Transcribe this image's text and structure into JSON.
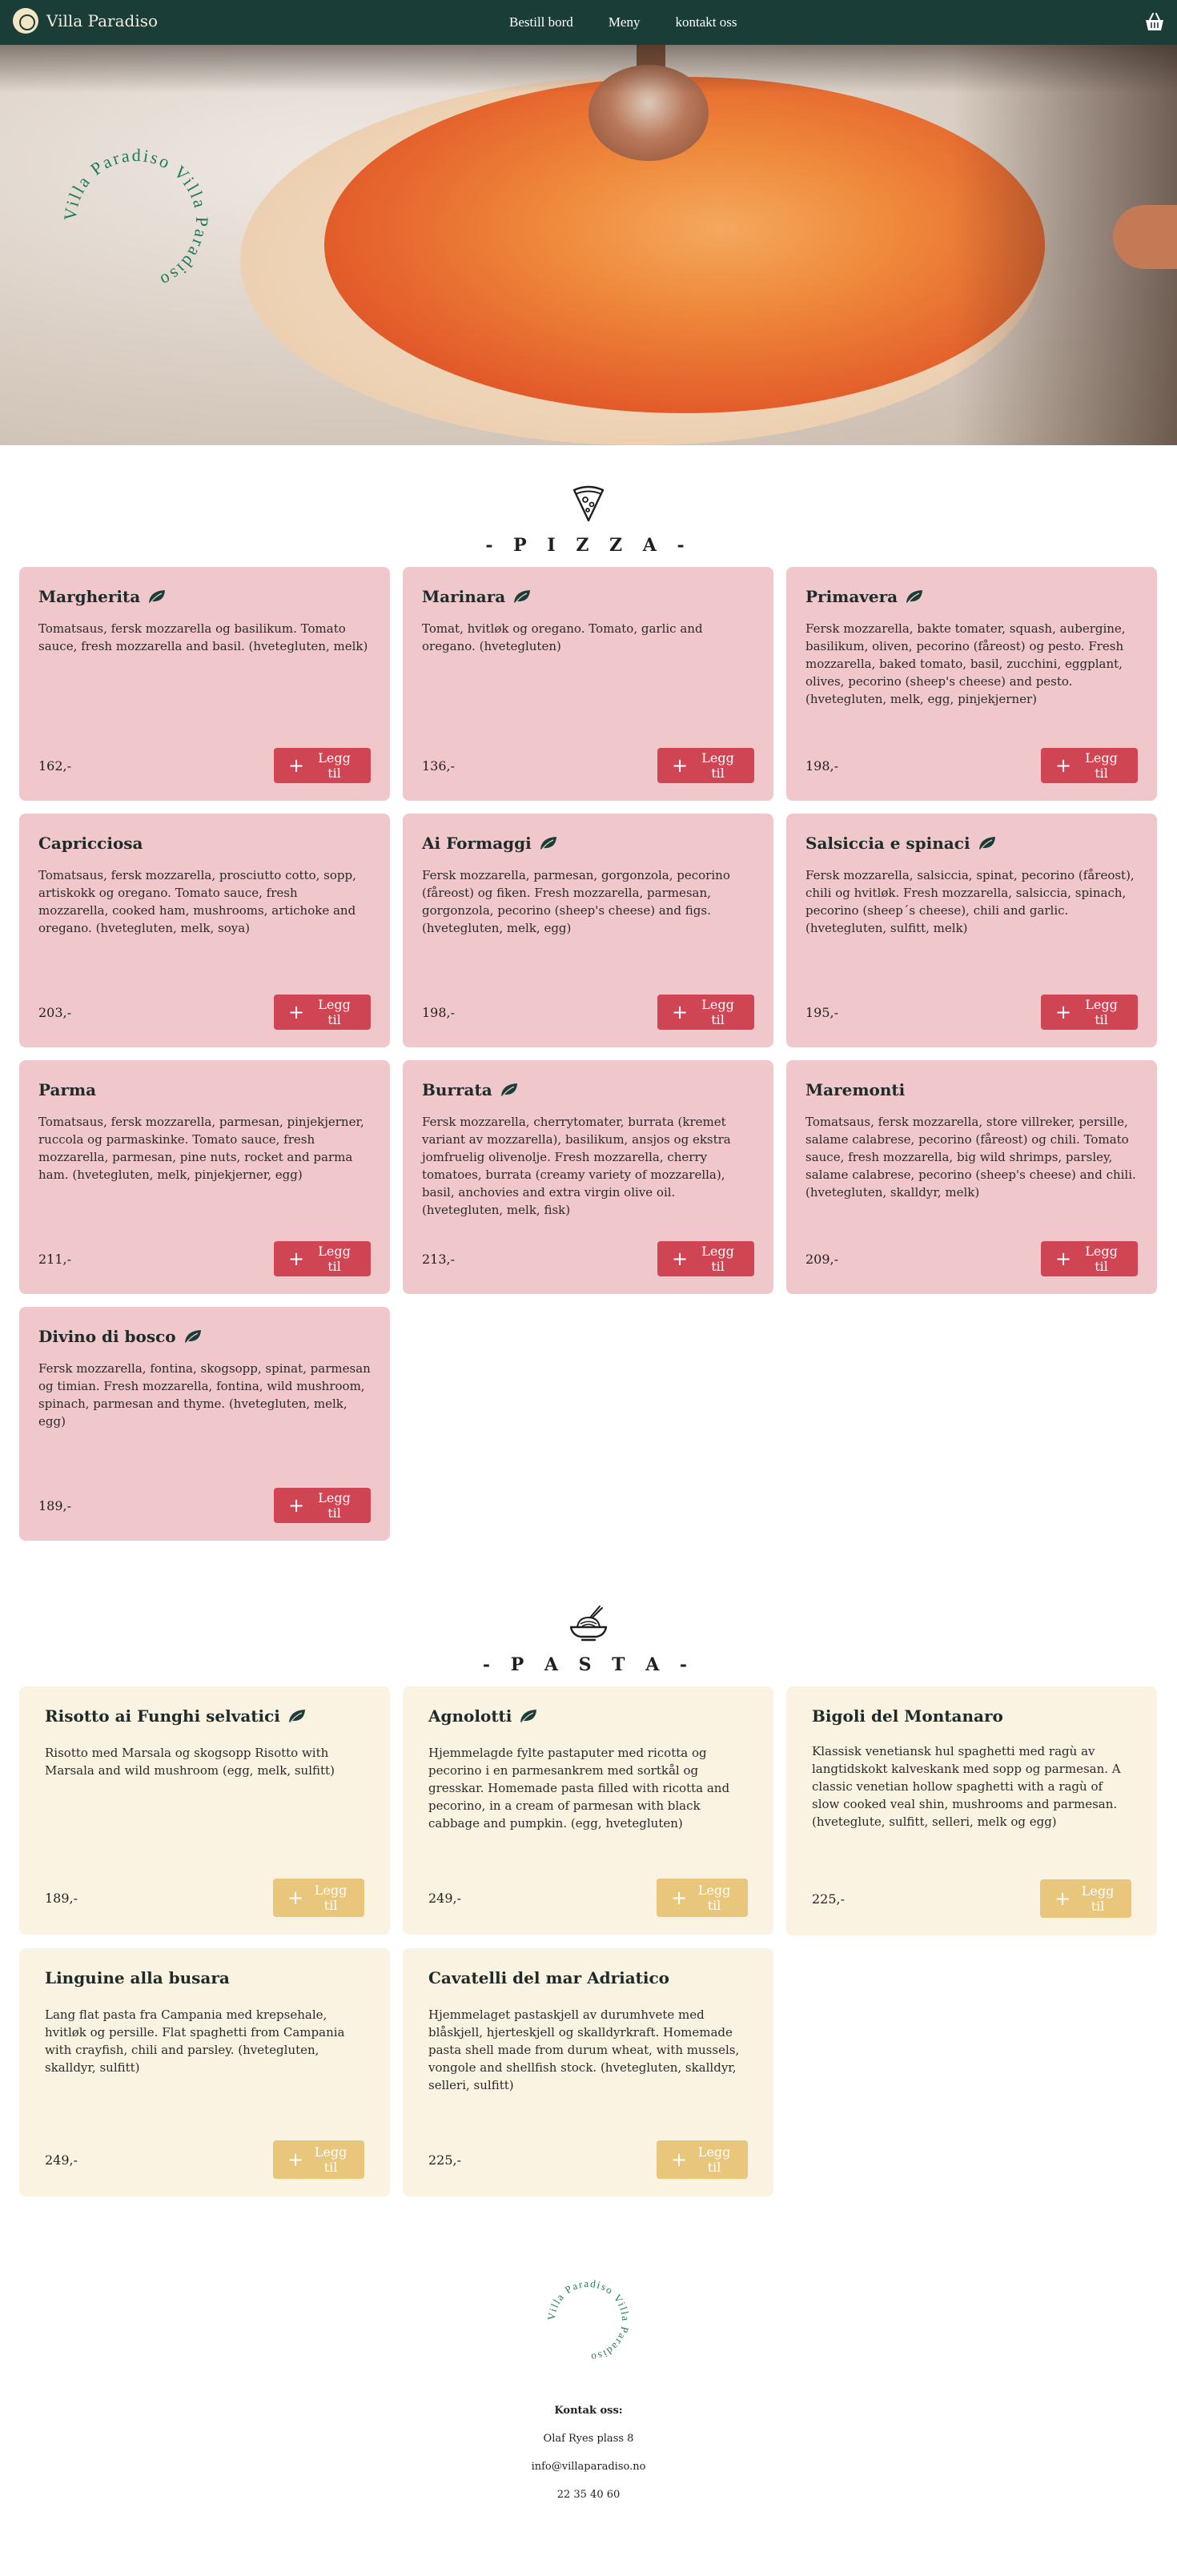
{
  "nav": {
    "brand": "Villa Paradiso",
    "links": [
      "Bestill bord",
      "Meny",
      "kontakt oss"
    ]
  },
  "hero": {
    "badge_text": "Villa Paradiso Villa Paradiso"
  },
  "pizza": {
    "title": "- P I Z Z A -",
    "items": [
      {
        "name": "Margherita",
        "veg": true,
        "desc": "Tomatsaus, fersk mozzarella og basilikum. Tomato sauce, fresh mozzarella and basil. (hvetegluten, melk)",
        "price": "162,-",
        "button": "Legg til"
      },
      {
        "name": "Marinara",
        "veg": true,
        "desc": "Tomat, hvitløk og oregano. Tomato, garlic and oregano. (hvetegluten)",
        "price": "136,-",
        "button": "Legg til"
      },
      {
        "name": "Primavera",
        "veg": true,
        "desc": "Fersk mozzarella, bakte tomater, squash, aubergine, basilikum, oliven, pecorino (fåreost) og pesto. Fresh mozzarella, baked tomato, basil, zucchini, eggplant, olives, pecorino (sheep's cheese) and pesto. (hvetegluten, melk, egg, pinjekjerner)",
        "price": "198,-",
        "button": "Legg til"
      },
      {
        "name": "Capricciosa",
        "veg": false,
        "desc": "Tomatsaus, fersk mozzarella, prosciutto cotto, sopp, artiskokk og oregano. Tomato sauce, fresh mozzarella, cooked ham, mushrooms, artichoke and oregano. (hvetegluten, melk, soya)",
        "price": "203,-",
        "button": "Legg til"
      },
      {
        "name": "Ai Formaggi",
        "veg": true,
        "desc": "Fersk mozzarella, parmesan, gorgonzola, pecorino (fåreost) og fiken. Fresh mozzarella, parmesan, gorgonzola, pecorino (sheep's cheese) and figs. (hvetegluten, melk, egg)",
        "price": "198,-",
        "button": "Legg til"
      },
      {
        "name": "Salsiccia e spinaci",
        "veg": true,
        "desc": "Fersk mozzarella, salsiccia, spinat, pecorino (fåreost), chili og hvitløk. Fresh mozzarella, salsiccia, spinach, pecorino (sheep´s cheese), chili and garlic. (hvetegluten, sulfitt, melk)",
        "price": "195,-",
        "button": "Legg til"
      },
      {
        "name": "Parma",
        "veg": false,
        "desc": "Tomatsaus, fersk mozzarella, parmesan, pinjekjerner, ruccola og parmaskinke. Tomato sauce, fresh mozzarella, parmesan, pine nuts, rocket and parma ham. (hvetegluten, melk, pinjekjerner, egg)",
        "price": "211,-",
        "button": "Legg til"
      },
      {
        "name": "Burrata",
        "veg": true,
        "desc": "Fersk mozzarella, cherrytomater, burrata (kremet variant av mozzarella), basilikum, ansjos og ekstra jomfruelig olivenolje. Fresh mozzarella, cherry tomatoes, burrata (creamy variety of mozzarella), basil, anchovies and extra virgin olive oil. (hvetegluten, melk, fisk)",
        "price": "213,-",
        "button": "Legg til"
      },
      {
        "name": "Maremonti",
        "veg": false,
        "desc": "Tomatsaus, fersk mozzarella, store villreker, persille, salame calabrese, pecorino (fåreost) og chili. Tomato sauce, fresh mozzarella, big wild shrimps, parsley, salame calabrese, pecorino (sheep's cheese) and chili. (hvetegluten, skalldyr, melk)",
        "price": "209,-",
        "button": "Legg til"
      },
      {
        "name": "Divino di bosco",
        "veg": true,
        "desc": "Fersk mozzarella, fontina, skogsopp, spinat, parmesan og timian. Fresh mozzarella, fontina, wild mushroom, spinach, parmesan and thyme. (hvetegluten, melk, egg)",
        "price": "189,-",
        "button": "Legg til"
      }
    ]
  },
  "pasta": {
    "title": "- P A S T A -",
    "items": [
      {
        "name": "Risotto ai Funghi selvatici",
        "veg": true,
        "desc": "Risotto med Marsala og skogsopp Risotto with Marsala and wild mushroom (egg, melk, sulfitt)",
        "price": "189,-",
        "button": "Legg til"
      },
      {
        "name": "Agnolotti",
        "veg": true,
        "desc": "Hjemmelagde fylte pastaputer med ricotta og pecorino i en parmesankrem med sortkål og gresskar. Homemade pasta filled with ricotta and pecorino, in a cream of parmesan with black cabbage and pumpkin. (egg, hvetegluten)",
        "price": "249,-",
        "button": "Legg til"
      },
      {
        "name": "Bigoli del Montanaro",
        "veg": false,
        "desc": "Klassisk venetiansk hul spaghetti med ragù av langtidskokt kalveskank med sopp og parmesan. A classic venetian hollow spaghetti with a ragù of slow cooked veal shin, mushrooms and parmesan. (hveteglute, sulfitt, selleri, melk og egg)",
        "price": "225,-",
        "button": "Legg til"
      },
      {
        "name": "Linguine alla busara",
        "veg": false,
        "desc": "Lang flat pasta fra Campania med krepsehale, hvitløk og persille. Flat spaghetti from Campania with crayfish, chili and parsley. (hvetegluten, skalldyr, sulfitt)",
        "price": "249,-",
        "button": "Legg til"
      },
      {
        "name": "Cavatelli del mar Adriatico",
        "veg": false,
        "desc": "Hjemmelaget pastaskjell av durumhvete med blåskjell, hjerteskjell og skalldyrkraft. Homemade pasta shell made from durum wheat, with mussels, vongole and shellfish stock. (hvetegluten, skalldyr, selleri, sulfitt)",
        "price": "225,-",
        "button": "Legg til"
      }
    ]
  },
  "footer": {
    "badge_text": "Villa Paradiso Villa Paradiso",
    "contact_heading": "Kontak oss:",
    "address": "Olaf Ryes plass 8",
    "email": "info@villaparadiso.no",
    "phone": "22 35 40 60"
  },
  "colors": {
    "nav_bg": "#1a3d38",
    "pizza_card": "#f0c7cb",
    "pizza_button": "#d04553",
    "pasta_card": "#fbf3e1",
    "pasta_button": "#e8c77d",
    "badge_green": "#1f7a5c"
  },
  "icons": {
    "cart": "shopping-basket-icon",
    "veg": "leaf-icon",
    "pizza_section": "pizza-slice-icon",
    "pasta_section": "pasta-plate-icon",
    "add": "plus-icon"
  }
}
